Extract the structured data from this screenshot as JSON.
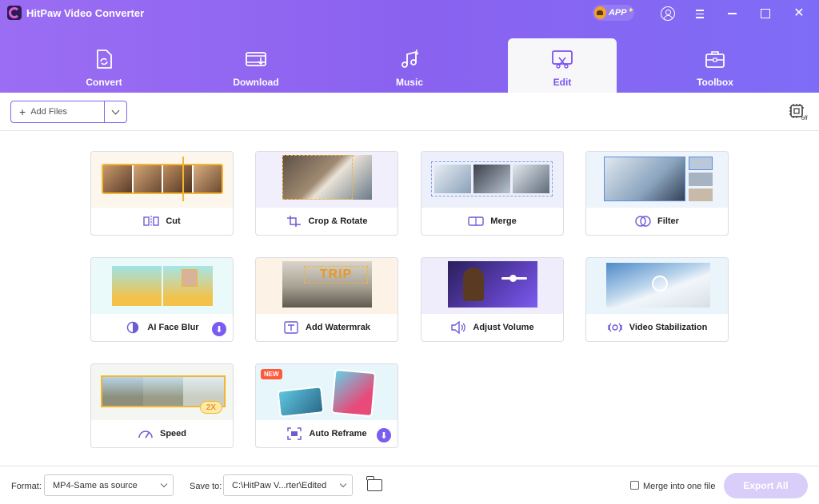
{
  "app": {
    "title": "HitPaw Video Converter",
    "app_badge": "APP"
  },
  "tabs": [
    {
      "label": "Convert"
    },
    {
      "label": "Download"
    },
    {
      "label": "Music"
    },
    {
      "label": "Edit"
    },
    {
      "label": "Toolbox"
    }
  ],
  "active_tab": "Edit",
  "toolbar": {
    "add_files_label": "Add Files"
  },
  "tools": [
    {
      "label": "Cut",
      "icon": "cut-icon"
    },
    {
      "label": "Crop & Rotate",
      "icon": "crop-icon"
    },
    {
      "label": "Merge",
      "icon": "merge-icon"
    },
    {
      "label": "Filter",
      "icon": "filter-icon"
    },
    {
      "label": "AI Face Blur",
      "icon": "face-blur-icon",
      "download": true
    },
    {
      "label": "Add Watermrak",
      "icon": "watermark-icon",
      "thumb_text": "TRIP"
    },
    {
      "label": "Adjust Volume",
      "icon": "volume-icon"
    },
    {
      "label": "Video Stabilization",
      "icon": "stabilization-icon"
    },
    {
      "label": "Speed",
      "icon": "speed-icon",
      "thumb_badge": "2X"
    },
    {
      "label": "Auto Reframe",
      "icon": "reframe-icon",
      "download": true,
      "badge": "NEW"
    }
  ],
  "footer": {
    "format_label": "Format:",
    "format_value": "MP4-Same as source",
    "save_to_label": "Save to:",
    "save_to_value": "C:\\HitPaw V...rter\\Edited",
    "merge_label": "Merge into one file",
    "export_label": "Export All"
  },
  "colors": {
    "accent": "#7b52f0",
    "header_start": "#9b6df3",
    "header_end": "#7f6cf6",
    "export_disabled": "#d9cdfa"
  }
}
